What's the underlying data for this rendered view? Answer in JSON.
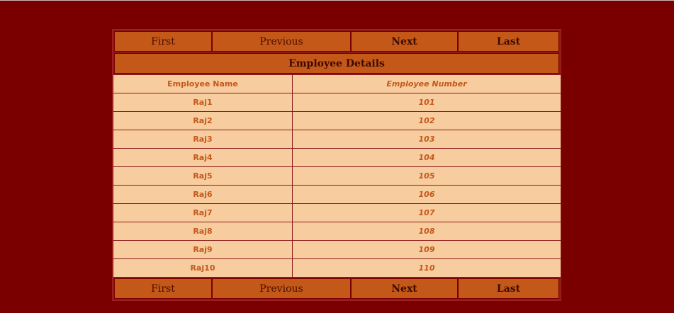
{
  "pager": {
    "first": "First",
    "previous": "Previous",
    "next": "Next",
    "last": "Last"
  },
  "title": "Employee Details",
  "table": {
    "headers": [
      "Employee Name",
      "Employee Number"
    ],
    "rows": [
      [
        "Raj1",
        "101"
      ],
      [
        "Raj2",
        "102"
      ],
      [
        "Raj3",
        "103"
      ],
      [
        "Raj4",
        "104"
      ],
      [
        "Raj5",
        "105"
      ],
      [
        "Raj6",
        "106"
      ],
      [
        "Raj7",
        "107"
      ],
      [
        "Raj8",
        "108"
      ],
      [
        "Raj9",
        "109"
      ],
      [
        "Raj10",
        "110"
      ]
    ]
  },
  "colors": {
    "page_background": "#7a0000",
    "bar_background": "#c45818",
    "cell_background": "#f7cc9e",
    "cell_text": "#c4581c"
  }
}
